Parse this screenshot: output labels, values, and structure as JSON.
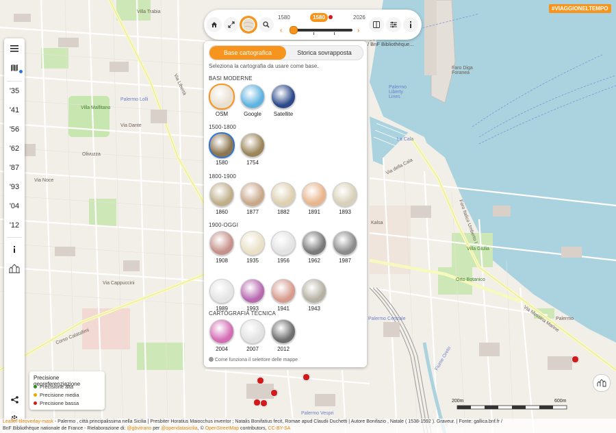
{
  "hashtag": "#VIAGGIONELTEMPO",
  "sidebar": {
    "menu_icon": "hamburger-menu-icon",
    "layers_icon": "map-layers-icon",
    "years": [
      "'35",
      "'41",
      "'56",
      "'62",
      "'87",
      "'93",
      "'04",
      "'12"
    ],
    "info_icon": "info-icon",
    "cityscape_icon": "cityscape-icon",
    "share_icon": "share-icon",
    "settings_icon": "gear-icon"
  },
  "topbar": {
    "home_icon": "home-icon",
    "fullscreen_icon": "expand-icon",
    "basemap_icon": "globe-icon",
    "search_icon": "search-icon",
    "year_start": "1580",
    "year_current": "1580",
    "year_end": "2026",
    "timeline_value_fraction": 0.0,
    "arrow_left": "‹",
    "arrow_right": "›",
    "split_icon": "split-view-icon",
    "sliders_icon": "sliders-icon",
    "info_icon": "info-icon"
  },
  "ghost_attribution": "/ BnF Bibliothèque...",
  "panel": {
    "tab_base": "Base cartografica",
    "tab_overlay": "Storica sovrapposta",
    "description": "Seleziona la cartografia da usare come base.",
    "sections": [
      {
        "title": "BASI MODERNE",
        "items": [
          {
            "label": "OSM",
            "color": "#e8dfd0",
            "selected": "osm"
          },
          {
            "label": "Google",
            "color": "#5fb3e0"
          },
          {
            "label": "Satellite",
            "color": "#2c4a8a"
          }
        ]
      },
      {
        "title": "1500-1800",
        "items": [
          {
            "label": "1580",
            "color": "#8c7550",
            "selected": "yes"
          },
          {
            "label": "1754",
            "color": "#9b8559"
          }
        ]
      },
      {
        "title": "1800-1900",
        "items": [
          {
            "label": "1860",
            "color": "#bfae89"
          },
          {
            "label": "1877",
            "color": "#c9a88a"
          },
          {
            "label": "1882",
            "color": "#ddd0b0"
          },
          {
            "label": "1891",
            "color": "#e8b58c"
          },
          {
            "label": "1893",
            "color": "#d8d0b8"
          }
        ]
      },
      {
        "title": "1900-OGGI",
        "items": [
          {
            "label": "1908",
            "color": "#c6918a"
          },
          {
            "label": "1935",
            "color": "#eae0c6"
          },
          {
            "label": "1956",
            "color": "#e3e3e3"
          },
          {
            "label": "1962",
            "color": "#7a7a7a"
          },
          {
            "label": "1987",
            "color": "#8c8c8c"
          },
          {
            "label": "1989",
            "color": "#e5e5e5"
          },
          {
            "label": "1993",
            "color": "#b869b0"
          },
          {
            "label": "1941",
            "color": "#d79b8d"
          },
          {
            "label": "1943",
            "color": "#b5b1a3"
          }
        ]
      },
      {
        "title": "CARTOGRAFIA TECNICA",
        "items": [
          {
            "label": "2004",
            "color": "#d36db4"
          },
          {
            "label": "2007",
            "color": "#e2e2e2"
          },
          {
            "label": "2012",
            "color": "#6e6e6e"
          }
        ]
      }
    ],
    "help_text": "Come funziona il selettore delle mappe"
  },
  "legend": {
    "title": "Precisione georeferenziazione",
    "items": [
      {
        "label": "Precisione alta",
        "color": "#2e8b2e"
      },
      {
        "label": "Precisione media",
        "color": "#e8a800"
      },
      {
        "label": "Precisione bassa",
        "color": "#d11b1b"
      }
    ]
  },
  "scale": {
    "left": "200m",
    "right": "600m"
  },
  "attribution": {
    "line1_prefix": "Leaflet-tileoverlay-mask",
    "line1": " - Palermo , città principalissima nella Sicilia | Presbiter Horatius Maiocchus inventor ; Natalis Bonifatius fecit, Romae apud Claudii Duchetti | Autore Bonifazio , Natale ( 1538-1592 ). Graveur. | Fonte: gallica.bnf.fr /",
    "line2_prefix": "BnF Bibliothèque nationale de France - Rielaborazione di: ",
    "line2_link1": "@gbvitrano",
    "line2_mid": " per ",
    "line2_link2": "@opendatasicilia",
    "line2_mid2": ", © ",
    "line2_link3": "OpenStreetMap",
    "line2_mid3": " contributors, ",
    "line2_link4": "CC-BY-SA"
  },
  "map_labels": {
    "villa_trabia": "Villa Trabia",
    "palermo_lolli": "Palermo Lolli",
    "villa_malfitano": "Villa Malfitano",
    "olivuzza": "Olivuzza",
    "faro": "Faro Diga Foranea",
    "palermo_liberty": "Palermo Liberty Lines",
    "la_cala": "La Cala",
    "via_della_cala": "Via della Cala",
    "foro_italico": "Foro Italico Umberto I",
    "villa_giulia": "Villa Giulia",
    "orto_botanico": "Orto Botanico",
    "kalsa": "Kalsa",
    "palermo_centrale": "Palermo Centrale",
    "via_messina_marine": "Via Messina Marine",
    "palermo_vespri": "Palermo Vespri",
    "corso_calatafimi": "Corso Calatafimi",
    "via_cappuccini": "Via Cappuccini",
    "fiume_oreto": "Fiume Oreto",
    "via_dante": "Via Dante",
    "via_noce": "Via Noce",
    "via_liberta": "Via Libertà",
    "palermo_label": "Palermo"
  }
}
